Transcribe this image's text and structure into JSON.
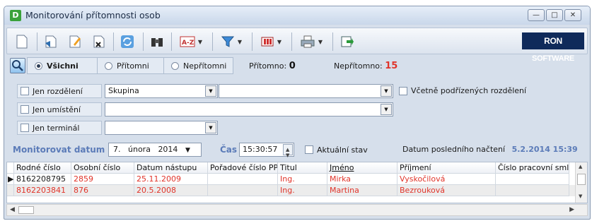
{
  "window": {
    "title": "Monitorování přítomnosti osob",
    "app_icon_letter": "D"
  },
  "toolbar": {
    "icons": [
      "new-doc-icon",
      "open-icon",
      "edit-icon",
      "delete-icon",
      "refresh-icon",
      "binoculars-icon",
      "sort-az-icon",
      "filter-icon",
      "columns-icon",
      "print-icon",
      "export-icon"
    ],
    "logo_ron": "RON",
    "logo_software": "SOFTWARE"
  },
  "filter": {
    "all_label": "Všichni",
    "present_label": "Přítomni",
    "absent_label": "Nepřítomni",
    "selected": "all",
    "present_count_label": "Přítomno:",
    "present_count": "0",
    "absent_count_label": "Nepřítomno:",
    "absent_count": "15"
  },
  "options": {
    "only_division_label": "Jen rozdělení",
    "division_type": "Skupina",
    "division_value": "",
    "include_sub_label": "Včetně podřízených rozdělení",
    "only_location_label": "Jen umístění",
    "location_value": "",
    "only_terminal_label": "Jen terminál",
    "terminal_value": ""
  },
  "monitor": {
    "date_label": "Monitorovat datum",
    "day": "7.",
    "month": "února",
    "year": "2014",
    "time_label": "Čas",
    "time_value": "15:30:57",
    "current_state_label": "Aktuální stav",
    "last_read_label": "Datum posledního načtení",
    "last_read_value": "5.2.2014 15:39"
  },
  "grid": {
    "columns": [
      "Rodné číslo",
      "Osobní číslo",
      "Datum nástupu",
      "Pořadové číslo PP",
      "Titul",
      "Jméno",
      "Příjmení",
      "Číslo pracovní smlo"
    ],
    "rows": [
      [
        "8162208795",
        "2859",
        "25.11.2009",
        "",
        "Ing.",
        "Mirka",
        "Vyskočilová",
        ""
      ],
      [
        "8162203841",
        "876",
        "20.5.2008",
        "",
        "Ing.",
        "Martina",
        "Bezrouková",
        ""
      ]
    ]
  },
  "colors": {
    "accent_blue": "#5b7bb8",
    "absent_red": "#e0342a",
    "logo_bg": "#0f2a5a"
  }
}
